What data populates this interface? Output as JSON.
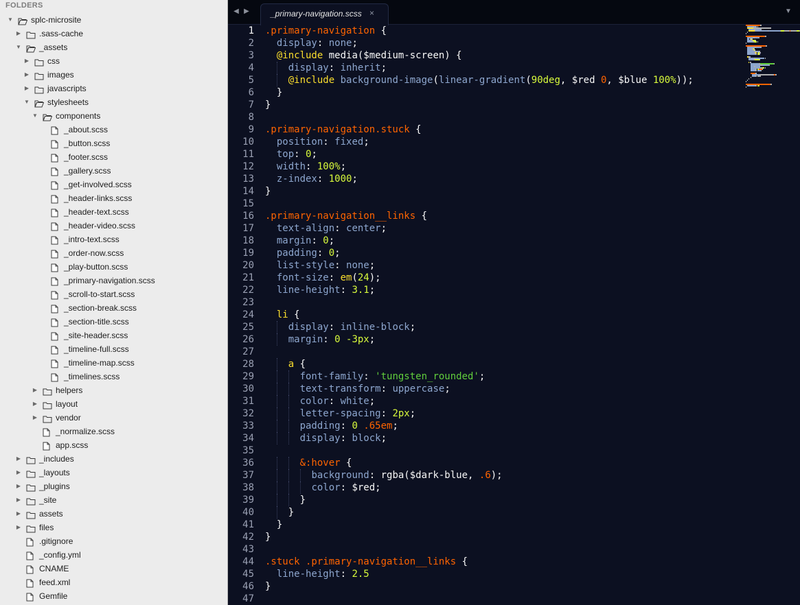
{
  "sidebar": {
    "title": "FOLDERS",
    "items": [
      {
        "label": "splc-microsite",
        "depth": 0,
        "type": "folder",
        "state": "open"
      },
      {
        "label": ".sass-cache",
        "depth": 1,
        "type": "folder",
        "state": "closed"
      },
      {
        "label": "_assets",
        "depth": 1,
        "type": "folder",
        "state": "open"
      },
      {
        "label": "css",
        "depth": 2,
        "type": "folder",
        "state": "closed"
      },
      {
        "label": "images",
        "depth": 2,
        "type": "folder",
        "state": "closed"
      },
      {
        "label": "javascripts",
        "depth": 2,
        "type": "folder",
        "state": "closed"
      },
      {
        "label": "stylesheets",
        "depth": 2,
        "type": "folder",
        "state": "open"
      },
      {
        "label": "components",
        "depth": 3,
        "type": "folder",
        "state": "open"
      },
      {
        "label": "_about.scss",
        "depth": 4,
        "type": "file"
      },
      {
        "label": "_button.scss",
        "depth": 4,
        "type": "file"
      },
      {
        "label": "_footer.scss",
        "depth": 4,
        "type": "file"
      },
      {
        "label": "_gallery.scss",
        "depth": 4,
        "type": "file"
      },
      {
        "label": "_get-involved.scss",
        "depth": 4,
        "type": "file"
      },
      {
        "label": "_header-links.scss",
        "depth": 4,
        "type": "file"
      },
      {
        "label": "_header-text.scss",
        "depth": 4,
        "type": "file"
      },
      {
        "label": "_header-video.scss",
        "depth": 4,
        "type": "file"
      },
      {
        "label": "_intro-text.scss",
        "depth": 4,
        "type": "file"
      },
      {
        "label": "_order-now.scss",
        "depth": 4,
        "type": "file"
      },
      {
        "label": "_play-button.scss",
        "depth": 4,
        "type": "file"
      },
      {
        "label": "_primary-navigation.scss",
        "depth": 4,
        "type": "file"
      },
      {
        "label": "_scroll-to-start.scss",
        "depth": 4,
        "type": "file"
      },
      {
        "label": "_section-break.scss",
        "depth": 4,
        "type": "file"
      },
      {
        "label": "_section-title.scss",
        "depth": 4,
        "type": "file"
      },
      {
        "label": "_site-header.scss",
        "depth": 4,
        "type": "file"
      },
      {
        "label": "_timeline-full.scss",
        "depth": 4,
        "type": "file"
      },
      {
        "label": "_timeline-map.scss",
        "depth": 4,
        "type": "file"
      },
      {
        "label": "_timelines.scss",
        "depth": 4,
        "type": "file"
      },
      {
        "label": "helpers",
        "depth": 3,
        "type": "folder",
        "state": "closed"
      },
      {
        "label": "layout",
        "depth": 3,
        "type": "folder",
        "state": "closed"
      },
      {
        "label": "vendor",
        "depth": 3,
        "type": "folder",
        "state": "closed"
      },
      {
        "label": "_normalize.scss",
        "depth": 3,
        "type": "file"
      },
      {
        "label": "app.scss",
        "depth": 3,
        "type": "file"
      },
      {
        "label": "_includes",
        "depth": 1,
        "type": "folder",
        "state": "closed"
      },
      {
        "label": "_layouts",
        "depth": 1,
        "type": "folder",
        "state": "closed"
      },
      {
        "label": "_plugins",
        "depth": 1,
        "type": "folder",
        "state": "closed"
      },
      {
        "label": "_site",
        "depth": 1,
        "type": "folder",
        "state": "closed"
      },
      {
        "label": "assets",
        "depth": 1,
        "type": "folder",
        "state": "closed"
      },
      {
        "label": "files",
        "depth": 1,
        "type": "folder",
        "state": "closed"
      },
      {
        "label": ".gitignore",
        "depth": 1,
        "type": "file"
      },
      {
        "label": "_config.yml",
        "depth": 1,
        "type": "file"
      },
      {
        "label": "CNAME",
        "depth": 1,
        "type": "file"
      },
      {
        "label": "feed.xml",
        "depth": 1,
        "type": "file"
      },
      {
        "label": "Gemfile",
        "depth": 1,
        "type": "file"
      }
    ]
  },
  "tabbar": {
    "back_icon": "triangle-left-icon",
    "forward_icon": "triangle-right-icon",
    "tab_label": "_primary-navigation.scss",
    "close_glyph": "×",
    "overflow_icon": "chevron-down-icon"
  },
  "editor": {
    "active_line": 1,
    "colors": {
      "background": "#0c1021",
      "selector": "#ff6400",
      "property": "#8da6ce",
      "number": "#d8fa3c",
      "at_rule": "#fbde2d",
      "string": "#61ce3c",
      "text": "#f8f8f8"
    },
    "lines": [
      [
        [
          "sel",
          ".primary-navigation"
        ],
        [
          "punc",
          " {"
        ]
      ],
      [
        [
          "ind",
          "  "
        ],
        [
          "prop",
          "display"
        ],
        [
          "punc",
          ": "
        ],
        [
          "pval",
          "none"
        ],
        [
          "punc",
          ";"
        ]
      ],
      [
        [
          "ind",
          "  "
        ],
        [
          "at",
          "@include"
        ],
        [
          "punc",
          " "
        ],
        [
          "fn",
          "media($medium-screen)"
        ],
        [
          "punc",
          " {"
        ]
      ],
      [
        [
          "ind",
          "    "
        ],
        [
          "prop",
          "display"
        ],
        [
          "punc",
          ": "
        ],
        [
          "pval",
          "inherit"
        ],
        [
          "punc",
          ";"
        ]
      ],
      [
        [
          "ind",
          "    "
        ],
        [
          "at",
          "@include"
        ],
        [
          "punc",
          " "
        ],
        [
          "pval",
          "background-image"
        ],
        [
          "punc",
          "("
        ],
        [
          "pval",
          "linear-gradient"
        ],
        [
          "punc",
          "("
        ],
        [
          "num",
          "90deg"
        ],
        [
          "punc",
          ", "
        ],
        [
          "var",
          "$red "
        ],
        [
          "orange",
          "0"
        ],
        [
          "punc",
          ", "
        ],
        [
          "var",
          "$blue "
        ],
        [
          "num",
          "100%"
        ],
        [
          "punc",
          "));"
        ]
      ],
      [
        [
          "ind",
          "  "
        ],
        [
          "punc",
          "}"
        ]
      ],
      [
        [
          "punc",
          "}"
        ]
      ],
      [],
      [
        [
          "sel",
          ".primary-navigation.stuck"
        ],
        [
          "punc",
          " {"
        ]
      ],
      [
        [
          "ind",
          "  "
        ],
        [
          "prop",
          "position"
        ],
        [
          "punc",
          ": "
        ],
        [
          "pval",
          "fixed"
        ],
        [
          "punc",
          ";"
        ]
      ],
      [
        [
          "ind",
          "  "
        ],
        [
          "prop",
          "top"
        ],
        [
          "punc",
          ": "
        ],
        [
          "num",
          "0"
        ],
        [
          "punc",
          ";"
        ]
      ],
      [
        [
          "ind",
          "  "
        ],
        [
          "prop",
          "width"
        ],
        [
          "punc",
          ": "
        ],
        [
          "num",
          "100%"
        ],
        [
          "punc",
          ";"
        ]
      ],
      [
        [
          "ind",
          "  "
        ],
        [
          "prop",
          "z-index"
        ],
        [
          "punc",
          ": "
        ],
        [
          "num",
          "1000"
        ],
        [
          "punc",
          ";"
        ]
      ],
      [
        [
          "punc",
          "}"
        ]
      ],
      [],
      [
        [
          "sel",
          ".primary-navigation__links"
        ],
        [
          "punc",
          " {"
        ]
      ],
      [
        [
          "ind",
          "  "
        ],
        [
          "prop",
          "text-align"
        ],
        [
          "punc",
          ": "
        ],
        [
          "pval",
          "center"
        ],
        [
          "punc",
          ";"
        ]
      ],
      [
        [
          "ind",
          "  "
        ],
        [
          "prop",
          "margin"
        ],
        [
          "punc",
          ": "
        ],
        [
          "num",
          "0"
        ],
        [
          "punc",
          ";"
        ]
      ],
      [
        [
          "ind",
          "  "
        ],
        [
          "prop",
          "padding"
        ],
        [
          "punc",
          ": "
        ],
        [
          "num",
          "0"
        ],
        [
          "punc",
          ";"
        ]
      ],
      [
        [
          "ind",
          "  "
        ],
        [
          "prop",
          "list-style"
        ],
        [
          "punc",
          ": "
        ],
        [
          "pval",
          "none"
        ],
        [
          "punc",
          ";"
        ]
      ],
      [
        [
          "ind",
          "  "
        ],
        [
          "prop",
          "font-size"
        ],
        [
          "punc",
          ": "
        ],
        [
          "kw",
          "em"
        ],
        [
          "punc",
          "("
        ],
        [
          "num",
          "24"
        ],
        [
          "punc",
          ");"
        ]
      ],
      [
        [
          "ind",
          "  "
        ],
        [
          "prop",
          "line-height"
        ],
        [
          "punc",
          ": "
        ],
        [
          "num",
          "3.1"
        ],
        [
          "punc",
          ";"
        ]
      ],
      [],
      [
        [
          "ind",
          "  "
        ],
        [
          "kw",
          "li"
        ],
        [
          "punc",
          " {"
        ]
      ],
      [
        [
          "ind",
          "    "
        ],
        [
          "prop",
          "display"
        ],
        [
          "punc",
          ": "
        ],
        [
          "pval",
          "inline-block"
        ],
        [
          "punc",
          ";"
        ]
      ],
      [
        [
          "ind",
          "    "
        ],
        [
          "prop",
          "margin"
        ],
        [
          "punc",
          ": "
        ],
        [
          "num",
          "0 -3px"
        ],
        [
          "punc",
          ";"
        ]
      ],
      [],
      [
        [
          "ind",
          "    "
        ],
        [
          "kw",
          "a"
        ],
        [
          "punc",
          " {"
        ]
      ],
      [
        [
          "ind",
          "      "
        ],
        [
          "prop",
          "font-family"
        ],
        [
          "punc",
          ": "
        ],
        [
          "str",
          "'tungsten_rounded'"
        ],
        [
          "punc",
          ";"
        ]
      ],
      [
        [
          "ind",
          "      "
        ],
        [
          "prop",
          "text-transform"
        ],
        [
          "punc",
          ": "
        ],
        [
          "pval",
          "uppercase"
        ],
        [
          "punc",
          ";"
        ]
      ],
      [
        [
          "ind",
          "      "
        ],
        [
          "prop",
          "color"
        ],
        [
          "punc",
          ": "
        ],
        [
          "pval",
          "white"
        ],
        [
          "punc",
          ";"
        ]
      ],
      [
        [
          "ind",
          "      "
        ],
        [
          "prop",
          "letter-spacing"
        ],
        [
          "punc",
          ": "
        ],
        [
          "num",
          "2px"
        ],
        [
          "punc",
          ";"
        ]
      ],
      [
        [
          "ind",
          "      "
        ],
        [
          "prop",
          "padding"
        ],
        [
          "punc",
          ": "
        ],
        [
          "num",
          "0 "
        ],
        [
          "orange",
          ".65em"
        ],
        [
          "punc",
          ";"
        ]
      ],
      [
        [
          "ind",
          "      "
        ],
        [
          "prop",
          "display"
        ],
        [
          "punc",
          ": "
        ],
        [
          "pval",
          "block"
        ],
        [
          "punc",
          ";"
        ]
      ],
      [],
      [
        [
          "ind",
          "      "
        ],
        [
          "amp",
          "&:hover"
        ],
        [
          "punc",
          " {"
        ]
      ],
      [
        [
          "ind",
          "        "
        ],
        [
          "prop",
          "background"
        ],
        [
          "punc",
          ": "
        ],
        [
          "fn",
          "rgba($dark-blue, "
        ],
        [
          "orange",
          ".6"
        ],
        [
          "punc",
          ");"
        ]
      ],
      [
        [
          "ind",
          "        "
        ],
        [
          "prop",
          "color"
        ],
        [
          "punc",
          ": "
        ],
        [
          "var",
          "$red"
        ],
        [
          "punc",
          ";"
        ]
      ],
      [
        [
          "ind",
          "      "
        ],
        [
          "punc",
          "}"
        ]
      ],
      [
        [
          "ind",
          "    "
        ],
        [
          "punc",
          "}"
        ]
      ],
      [
        [
          "ind",
          "  "
        ],
        [
          "punc",
          "}"
        ]
      ],
      [
        [
          "punc",
          "}"
        ]
      ],
      [],
      [
        [
          "sel",
          ".stuck .primary-navigation__links"
        ],
        [
          "punc",
          " {"
        ]
      ],
      [
        [
          "ind",
          "  "
        ],
        [
          "prop",
          "line-height"
        ],
        [
          "punc",
          ": "
        ],
        [
          "num",
          "2.5"
        ]
      ],
      [
        [
          "punc",
          "}"
        ]
      ],
      []
    ]
  }
}
